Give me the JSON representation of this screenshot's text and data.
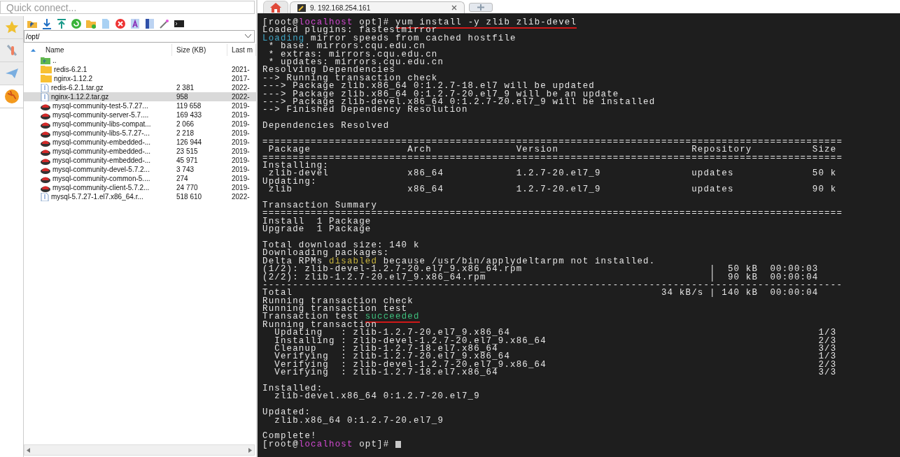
{
  "quick_connect": {
    "placeholder": "Quick connect..."
  },
  "side_tabs": [
    {
      "kind": "star",
      "selected": false
    },
    {
      "kind": "tools",
      "selected": false
    },
    {
      "kind": "plane",
      "selected": false
    },
    {
      "kind": "globe",
      "selected": true
    }
  ],
  "path": {
    "value": "/opt/"
  },
  "file_table": {
    "columns": [
      {
        "label": "Name",
        "sort_ascending": true
      },
      {
        "label": "Size (KB)"
      },
      {
        "label": "Last m"
      }
    ],
    "rows": [
      {
        "kind": "up",
        "name": "..",
        "selected": false
      },
      {
        "kind": "folder",
        "name": "redis-6.2.1",
        "date": "2021-",
        "selected": false
      },
      {
        "kind": "folder",
        "name": "nginx-1.12.2",
        "date": "2017-",
        "selected": false
      },
      {
        "kind": "archive",
        "name": "redis-6.2.1.tar.gz",
        "size": "2 381",
        "date": "2022-",
        "selected": false
      },
      {
        "kind": "archive",
        "name": "nginx-1.12.2.tar.gz",
        "size": "958",
        "date": "2022-",
        "selected": true
      },
      {
        "kind": "rpm",
        "name": "mysql-community-test-5.7.27...",
        "size": "119 658",
        "date": "2019-",
        "selected": false
      },
      {
        "kind": "rpm",
        "name": "mysql-community-server-5.7....",
        "size": "169 433",
        "date": "2019-",
        "selected": false
      },
      {
        "kind": "rpm",
        "name": "mysql-community-libs-compat...",
        "size": "2 066",
        "date": "2019-",
        "selected": false
      },
      {
        "kind": "rpm",
        "name": "mysql-community-libs-5.7.27-...",
        "size": "2 218",
        "date": "2019-",
        "selected": false
      },
      {
        "kind": "rpm",
        "name": "mysql-community-embedded-...",
        "size": "126 944",
        "date": "2019-",
        "selected": false
      },
      {
        "kind": "rpm",
        "name": "mysql-community-embedded-...",
        "size": "23 515",
        "date": "2019-",
        "selected": false
      },
      {
        "kind": "rpm",
        "name": "mysql-community-embedded-...",
        "size": "45 971",
        "date": "2019-",
        "selected": false
      },
      {
        "kind": "rpm",
        "name": "mysql-community-devel-5.7.2...",
        "size": "3 743",
        "date": "2019-",
        "selected": false
      },
      {
        "kind": "rpm",
        "name": "mysql-community-common-5....",
        "size": "274",
        "date": "2019-",
        "selected": false
      },
      {
        "kind": "rpm",
        "name": "mysql-community-client-5.7.2...",
        "size": "24 770",
        "date": "2019-",
        "selected": false
      },
      {
        "kind": "archive",
        "name": "mysql-5.7.27-1.el7.x86_64.r...",
        "size": "518 610",
        "date": "2022-",
        "selected": false
      }
    ]
  },
  "tabs": [
    {
      "kind": "home",
      "selected": false
    },
    {
      "kind": "session",
      "label": "9. 192.168.254.161",
      "selected": true
    },
    {
      "kind": "new",
      "selected": false
    }
  ],
  "terminal": {
    "cursor": true,
    "lines": [
      {
        "kind": "text",
        "segments": [
          {
            "text": "[root@",
            "kind": "plain"
          },
          {
            "text": "localhost",
            "kind": "host"
          },
          {
            "text": " opt]# ",
            "kind": "plain"
          },
          {
            "text": "yum install -y zlib zlib-devel",
            "kind": "marked"
          }
        ]
      },
      {
        "kind": "text",
        "segments": [
          {
            "text": "Loaded plugins: fastestmirror",
            "kind": "plain"
          }
        ]
      },
      {
        "kind": "text",
        "segments": [
          {
            "text": "Loading",
            "kind": "info"
          },
          {
            "text": " mirror speeds from cached hostfile",
            "kind": "plain"
          }
        ]
      },
      {
        "kind": "text",
        "segments": [
          {
            "text": " * base: mirrors.cqu.edu.cn",
            "kind": "plain"
          }
        ]
      },
      {
        "kind": "text",
        "segments": [
          {
            "text": " * extras: mirrors.cqu.edu.cn",
            "kind": "plain"
          }
        ]
      },
      {
        "kind": "text",
        "segments": [
          {
            "text": " * updates: mirrors.cqu.edu.cn",
            "kind": "plain"
          }
        ]
      },
      {
        "kind": "text",
        "segments": [
          {
            "text": "Resolving Dependencies",
            "kind": "plain"
          }
        ]
      },
      {
        "kind": "text",
        "segments": [
          {
            "text": "--> Running transaction check",
            "kind": "plain"
          }
        ]
      },
      {
        "kind": "text",
        "segments": [
          {
            "text": "---> Package zlib.x86_64 0:1.2.7-18.el7 will be updated",
            "kind": "plain"
          }
        ]
      },
      {
        "kind": "text",
        "segments": [
          {
            "text": "---> Package zlib.x86_64 0:1.2.7-20.el7_9 will be an update",
            "kind": "plain"
          }
        ]
      },
      {
        "kind": "text",
        "segments": [
          {
            "text": "---> Package zlib-devel.x86_64 0:1.2.7-20.el7_9 will be installed",
            "kind": "plain"
          }
        ]
      },
      {
        "kind": "text",
        "segments": [
          {
            "text": "--> Finished Dependency Resolution",
            "kind": "plain"
          }
        ]
      },
      {
        "kind": "blank"
      },
      {
        "kind": "text",
        "segments": [
          {
            "text": "Dependencies Resolved",
            "kind": "plain"
          }
        ]
      },
      {
        "kind": "blank"
      },
      {
        "kind": "text",
        "segments": [
          {
            "text": "================================================================================================",
            "kind": "plain"
          }
        ]
      },
      {
        "kind": "text",
        "segments": [
          {
            "text": " Package                Arch              Version                      Repository          Size",
            "kind": "plain"
          }
        ]
      },
      {
        "kind": "text",
        "segments": [
          {
            "text": "================================================================================================",
            "kind": "plain"
          }
        ]
      },
      {
        "kind": "text",
        "segments": [
          {
            "text": "Installing:",
            "kind": "plain"
          }
        ]
      },
      {
        "kind": "text",
        "segments": [
          {
            "text": " zlib-devel             x86_64            1.2.7-20.el7_9               updates             50 k",
            "kind": "plain"
          }
        ]
      },
      {
        "kind": "text",
        "segments": [
          {
            "text": "Updating:",
            "kind": "plain"
          }
        ]
      },
      {
        "kind": "text",
        "segments": [
          {
            "text": " zlib                   x86_64            1.2.7-20.el7_9               updates             90 k",
            "kind": "plain"
          }
        ]
      },
      {
        "kind": "blank"
      },
      {
        "kind": "text",
        "segments": [
          {
            "text": "Transaction Summary",
            "kind": "plain"
          }
        ]
      },
      {
        "kind": "text",
        "segments": [
          {
            "text": "================================================================================================",
            "kind": "plain"
          }
        ]
      },
      {
        "kind": "text",
        "segments": [
          {
            "text": "Install  1 Package",
            "kind": "plain"
          }
        ]
      },
      {
        "kind": "text",
        "segments": [
          {
            "text": "Upgrade  1 Package",
            "kind": "plain"
          }
        ]
      },
      {
        "kind": "blank"
      },
      {
        "kind": "text",
        "segments": [
          {
            "text": "Total download size: 140 k",
            "kind": "plain"
          }
        ]
      },
      {
        "kind": "text",
        "segments": [
          {
            "text": "Downloading packages:",
            "kind": "plain"
          }
        ]
      },
      {
        "kind": "text",
        "segments": [
          {
            "text": "Delta RPMs ",
            "kind": "plain"
          },
          {
            "text": "disabled",
            "kind": "warn"
          },
          {
            "text": " because /usr/bin/applydeltarpm not installed.",
            "kind": "plain"
          }
        ]
      },
      {
        "kind": "text",
        "segments": [
          {
            "text": "(1/2): zlib-devel-1.2.7-20.el7_9.x86_64.rpm                               |  50 kB  00:00:03",
            "kind": "plain"
          }
        ]
      },
      {
        "kind": "text",
        "segments": [
          {
            "text": "(2/2): zlib-1.2.7-20.el7_9.x86_64.rpm                                     |  90 kB  00:00:04",
            "kind": "plain"
          }
        ]
      },
      {
        "kind": "text",
        "segments": [
          {
            "text": "------------------------------------------------------------------------------------------------",
            "kind": "plain"
          }
        ]
      },
      {
        "kind": "text",
        "segments": [
          {
            "text": "Total                                                             34 kB/s | 140 kB  00:00:04",
            "kind": "plain"
          }
        ]
      },
      {
        "kind": "text",
        "segments": [
          {
            "text": "Running transaction check",
            "kind": "plain"
          }
        ]
      },
      {
        "kind": "text",
        "segments": [
          {
            "text": "Running transaction test",
            "kind": "plain"
          }
        ]
      },
      {
        "kind": "text",
        "segments": [
          {
            "text": "Transaction test ",
            "kind": "plain"
          },
          {
            "text": "succeeded",
            "kind": "success"
          }
        ]
      },
      {
        "kind": "text",
        "segments": [
          {
            "text": "Running transaction",
            "kind": "plain"
          }
        ]
      },
      {
        "kind": "text",
        "segments": [
          {
            "text": "  Updating   : zlib-1.2.7-20.el7_9.x86_64                                                   1/3",
            "kind": "plain"
          }
        ]
      },
      {
        "kind": "text",
        "segments": [
          {
            "text": "  Installing : zlib-devel-1.2.7-20.el7_9.x86_64                                             2/3",
            "kind": "plain"
          }
        ]
      },
      {
        "kind": "text",
        "segments": [
          {
            "text": "  Cleanup    : zlib-1.2.7-18.el7.x86_64                                                     3/3",
            "kind": "plain"
          }
        ]
      },
      {
        "kind": "text",
        "segments": [
          {
            "text": "  Verifying  : zlib-1.2.7-20.el7_9.x86_64                                                   1/3",
            "kind": "plain"
          }
        ]
      },
      {
        "kind": "text",
        "segments": [
          {
            "text": "  Verifying  : zlib-devel-1.2.7-20.el7_9.x86_64                                             2/3",
            "kind": "plain"
          }
        ]
      },
      {
        "kind": "text",
        "segments": [
          {
            "text": "  Verifying  : zlib-1.2.7-18.el7.x86_64                                                     3/3",
            "kind": "plain"
          }
        ]
      },
      {
        "kind": "blank"
      },
      {
        "kind": "text",
        "segments": [
          {
            "text": "Installed:",
            "kind": "plain"
          }
        ]
      },
      {
        "kind": "text",
        "segments": [
          {
            "text": "  zlib-devel.x86_64 0:1.2.7-20.el7_9",
            "kind": "plain"
          }
        ]
      },
      {
        "kind": "blank"
      },
      {
        "kind": "text",
        "segments": [
          {
            "text": "Updated:",
            "kind": "plain"
          }
        ]
      },
      {
        "kind": "text",
        "segments": [
          {
            "text": "  zlib.x86_64 0:1.2.7-20.el7_9",
            "kind": "plain"
          }
        ]
      },
      {
        "kind": "blank"
      },
      {
        "kind": "text",
        "segments": [
          {
            "text": "Complete!",
            "kind": "plain"
          }
        ]
      },
      {
        "kind": "text",
        "segments": [
          {
            "text": "[root@",
            "kind": "plain"
          },
          {
            "text": "localhost",
            "kind": "host"
          },
          {
            "text": " opt]# ",
            "kind": "plain"
          }
        ]
      }
    ]
  }
}
